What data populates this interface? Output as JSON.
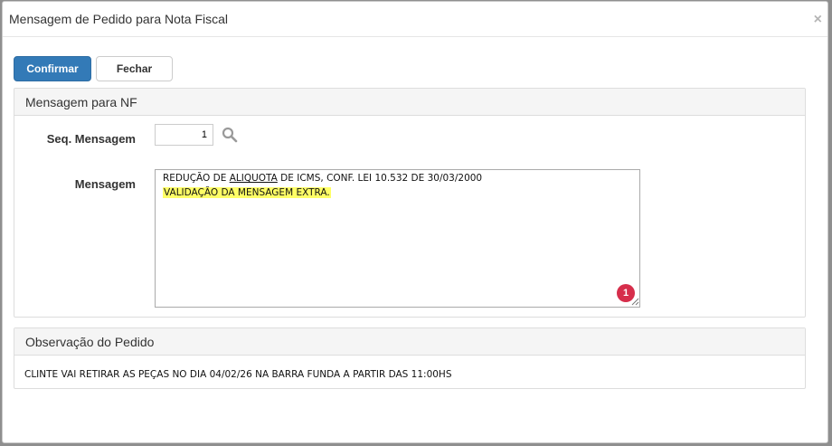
{
  "modal": {
    "title": "Mensagem de Pedido para Nota Fiscal",
    "close_symbol": "×"
  },
  "toolbar": {
    "confirm_label": "Confirmar",
    "close_label": "Fechar",
    "confirm_color": "#337ab7"
  },
  "nf_panel": {
    "heading": "Mensagem para NF",
    "seq_label": "Seq. Mensagem",
    "seq_value": "1",
    "search_icon": "search-icon",
    "message_label": "Mensagem",
    "message_line1_pre": "REDUÇÃO DE ",
    "message_line1_underlined": "ALIQUOTA",
    "message_line1_post": " DE ICMS, CONF. LEI 10.532 DE 30/03/2000",
    "message_line2": "VALIDAÇÃO DA MENSAGEM EXTRA.",
    "highlight_color": "#ffff66",
    "badge_count": "1",
    "badge_color": "#d62e4b"
  },
  "obs_panel": {
    "heading": "Observação do Pedido",
    "text": "CLINTE VAI RETIRAR AS PEÇAS NO DIA 04/02/26 NA BARRA FUNDA A PARTIR DAS 11:00HS"
  }
}
